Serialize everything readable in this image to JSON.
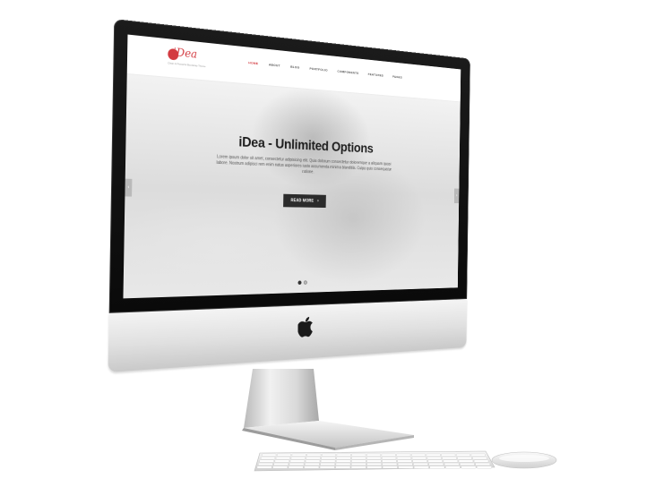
{
  "device": {
    "brand_icon": "apple-logo-icon"
  },
  "site": {
    "logo_text": "iDea",
    "logo_tagline": "Clean & Powerful Bootstrap Theme",
    "nav": [
      {
        "label": "HOME",
        "active": true
      },
      {
        "label": "ABOUT",
        "active": false
      },
      {
        "label": "BLOG",
        "active": false
      },
      {
        "label": "PORTFOLIO",
        "active": false
      },
      {
        "label": "COMPONENTS",
        "active": false
      },
      {
        "label": "FEATURES",
        "active": false
      },
      {
        "label": "PAGES",
        "active": false
      }
    ],
    "hero": {
      "title": "iDea - Unlimited Options",
      "body": "Lorem ipsum dolor sit amet, consectetur adipisicing elit. Quia dolorum consectetur doloremque a aliquam quasi labore. Nostrum adipisci rem enim natus asperiores iusto assumenda minima blanditiis. Culpa quis consequatur ratione.",
      "button_label": "READ MORE",
      "button_icon": "chevron-right-icon",
      "slide_count": 2,
      "active_slide": 1
    }
  },
  "colors": {
    "brand": "#d33a40",
    "button_bg": "#2b2b2b",
    "bezel": "#111111"
  }
}
